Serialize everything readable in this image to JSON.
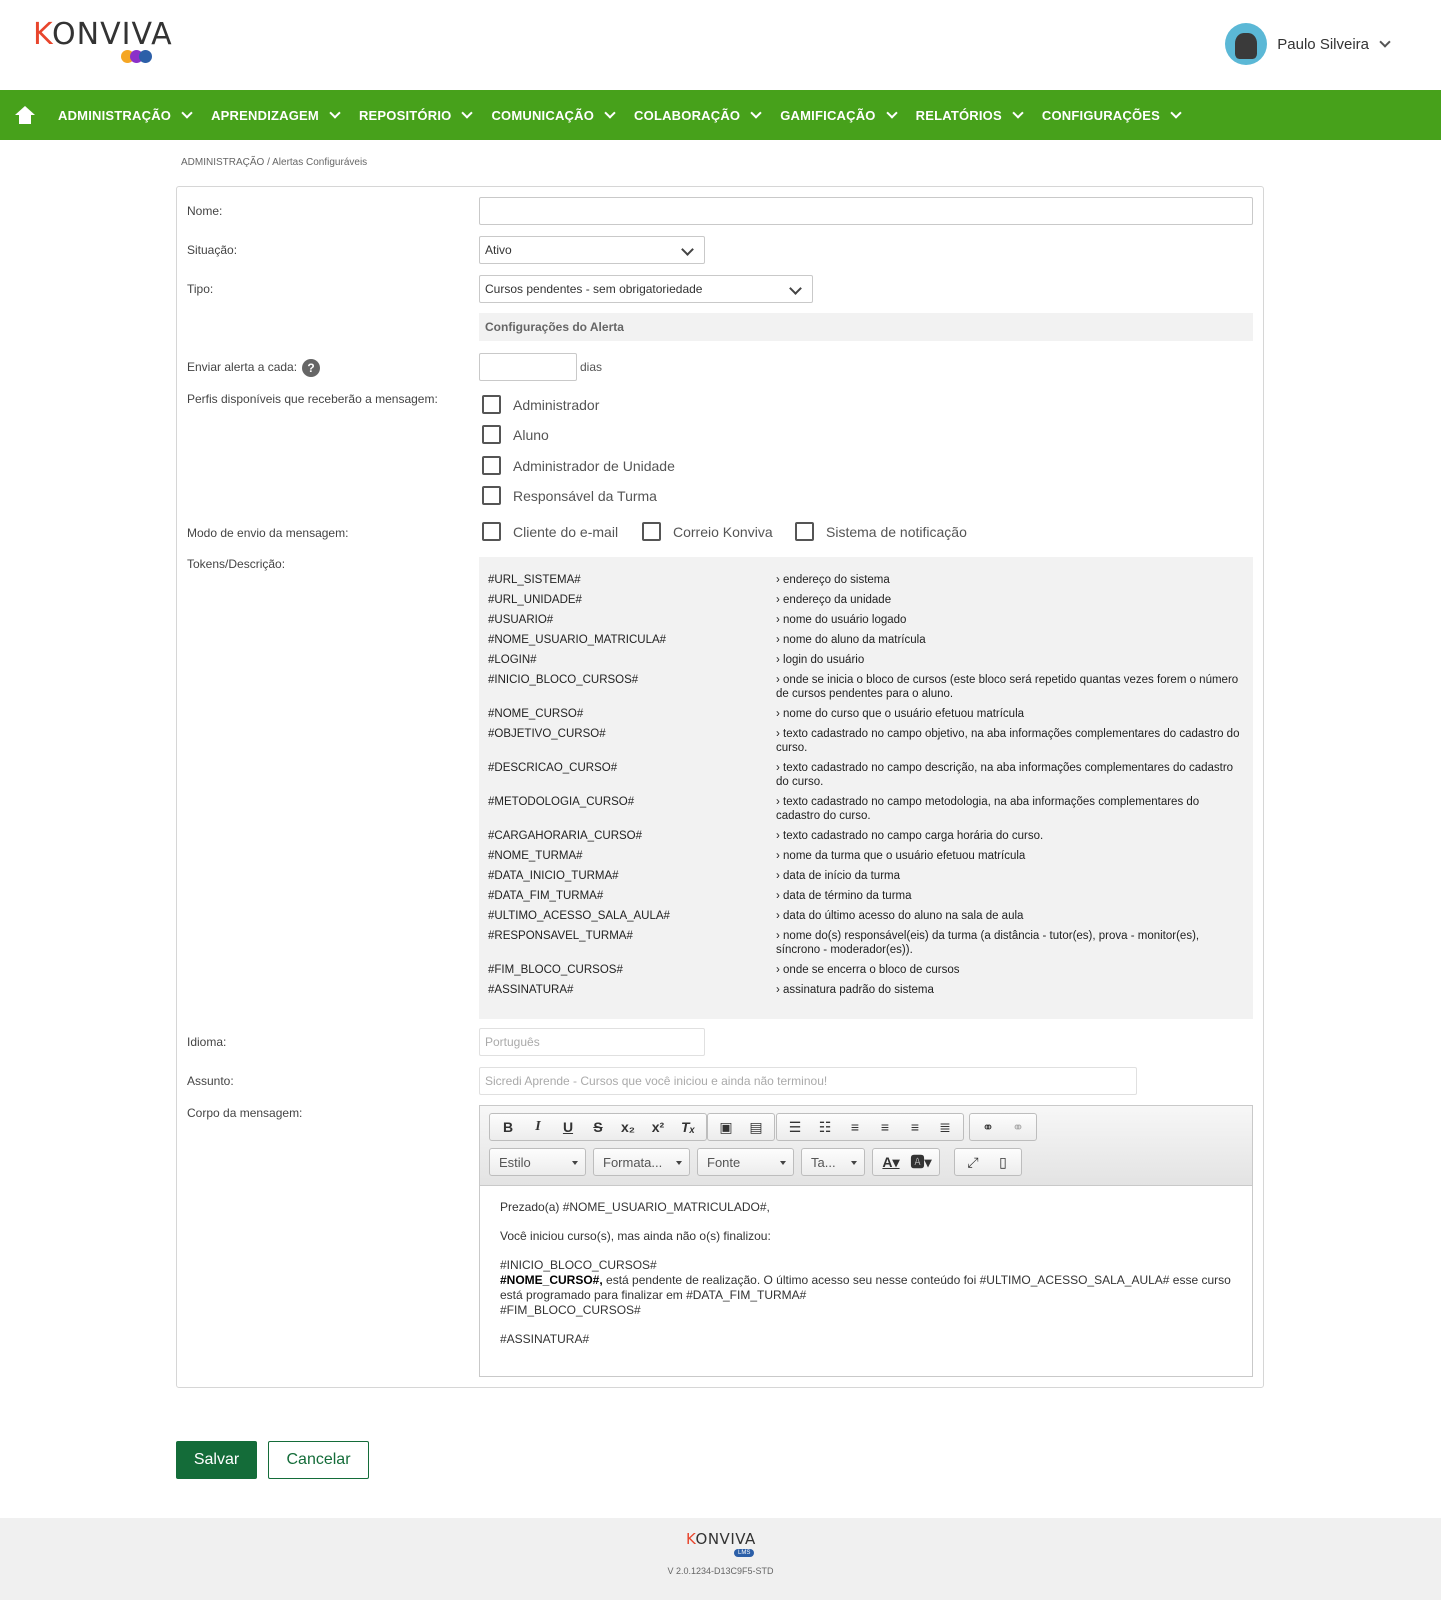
{
  "header": {
    "logo_text": "KONVIVA",
    "user_name": "Paulo Silveira"
  },
  "nav": {
    "items": [
      {
        "label": "ADMINISTRAÇÃO"
      },
      {
        "label": "APRENDIZAGEM"
      },
      {
        "label": "REPOSITÓRIO"
      },
      {
        "label": "COMUNICAÇÃO"
      },
      {
        "label": "COLABORAÇÃO"
      },
      {
        "label": "GAMIFICAÇÃO"
      },
      {
        "label": "RELATÓRIOS"
      },
      {
        "label": "CONFIGURAÇÕES"
      }
    ]
  },
  "breadcrumb": "ADMINISTRAÇÃO / Alertas Configuráveis",
  "form": {
    "nome_label": "Nome:",
    "nome_value": "",
    "situacao_label": "Situação:",
    "situacao_value": "Ativo",
    "tipo_label": "Tipo:",
    "tipo_value": "Cursos pendentes - sem obrigatoriedade",
    "section_title": "Configurações do Alerta",
    "enviar_label": "Enviar alerta a cada:",
    "enviar_value": "",
    "enviar_unit": "dias",
    "perfis_label": "Perfis disponíveis que receberão a mensagem:",
    "perfis": [
      "Administrador",
      "Aluno",
      "Administrador de Unidade",
      "Responsável da Turma"
    ],
    "modo_label": "Modo de envio da mensagem:",
    "modos": [
      "Cliente do e-mail",
      "Correio Konviva",
      "Sistema de notificação"
    ],
    "tokens_label": "Tokens/Descrição:",
    "tokens": [
      {
        "name": "#URL_SISTEMA#",
        "desc": "› endereço do sistema"
      },
      {
        "name": "#URL_UNIDADE#",
        "desc": "› endereço da unidade"
      },
      {
        "name": "#USUARIO#",
        "desc": "› nome do usuário logado"
      },
      {
        "name": "#NOME_USUARIO_MATRICULA#",
        "desc": "› nome do aluno da matrícula"
      },
      {
        "name": "#LOGIN#",
        "desc": "› login do usuário"
      },
      {
        "name": "#INICIO_BLOCO_CURSOS#",
        "desc": "› onde se inicia o bloco de cursos (este bloco será repetido quantas vezes forem o número de cursos pendentes para o aluno."
      },
      {
        "name": "#NOME_CURSO#",
        "desc": "› nome do curso que o usuário efetuou matrícula"
      },
      {
        "name": "#OBJETIVO_CURSO#",
        "desc": "› texto cadastrado no campo objetivo, na aba informações complementares do cadastro do curso."
      },
      {
        "name": "#DESCRICAO_CURSO#",
        "desc": "› texto cadastrado no campo descrição, na aba informações complementares do cadastro do curso."
      },
      {
        "name": "#METODOLOGIA_CURSO#",
        "desc": "› texto cadastrado no campo metodologia, na aba informações complementares do cadastro do curso."
      },
      {
        "name": "#CARGAHORARIA_CURSO#",
        "desc": "› texto cadastrado no campo carga horária do curso."
      },
      {
        "name": "#NOME_TURMA#",
        "desc": "› nome da turma que o usuário efetuou matrícula"
      },
      {
        "name": "#DATA_INICIO_TURMA#",
        "desc": "› data de início da turma"
      },
      {
        "name": "#DATA_FIM_TURMA#",
        "desc": "› data de término da turma"
      },
      {
        "name": "#ULTIMO_ACESSO_SALA_AULA#",
        "desc": "› data do último acesso do aluno na sala de aula"
      },
      {
        "name": "#RESPONSAVEL_TURMA#",
        "desc": "› nome do(s) responsável(eis) da turma (a distância - tutor(es), prova - monitor(es), síncrono - moderador(es))."
      },
      {
        "name": "#FIM_BLOCO_CURSOS#",
        "desc": "› onde se encerra o bloco de cursos"
      },
      {
        "name": "#ASSINATURA#",
        "desc": "› assinatura padrão do sistema"
      }
    ],
    "idioma_label": "Idioma:",
    "idioma_placeholder": "Português",
    "assunto_label": "Assunto:",
    "assunto_placeholder": "Sicredi Aprende - Cursos que você iniciou e ainda não terminou!",
    "corpo_label": "Corpo da mensagem:"
  },
  "editor": {
    "combo_estilo": "Estilo",
    "combo_formata": "Formata...",
    "combo_fonte": "Fonte",
    "combo_tamanho": "Ta...",
    "body": {
      "line1": "Prezado(a) #NOME_USUARIO_MATRICULADO#,",
      "line2": "Você iniciou curso(s), mas ainda não o(s) finalizou:",
      "line3": "#INICIO_BLOCO_CURSOS#",
      "line4_bold": "#NOME_CURSO#,",
      "line4_rest": " está pendente de realização. O último acesso seu nesse conteúdo foi #ULTIMO_ACESSO_SALA_AULA#  esse curso está programado para finalizar em #DATA_FIM_TURMA#",
      "line5": "#FIM_BLOCO_CURSOS#",
      "line6": "#ASSINATURA#"
    }
  },
  "actions": {
    "save": "Salvar",
    "cancel": "Cancelar"
  },
  "footer": {
    "logo_text": "KONVIVA",
    "badge": "LMS",
    "version": "V 2.0.1234-D13C9F5-STD"
  },
  "colors": {
    "nav_green": "#47a11b",
    "save_green": "#146c39"
  }
}
